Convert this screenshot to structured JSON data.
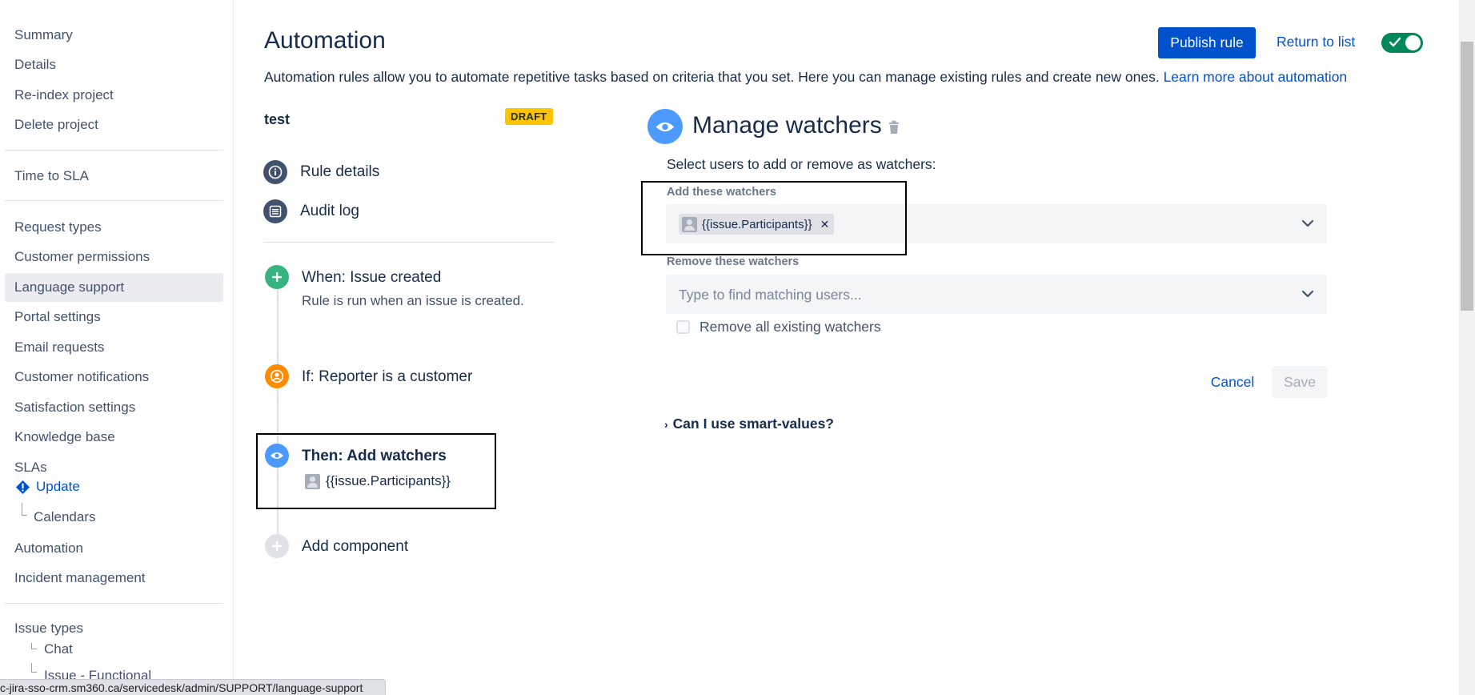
{
  "sidebar": {
    "items": [
      {
        "label": "Summary"
      },
      {
        "label": "Details"
      },
      {
        "label": "Re-index project"
      },
      {
        "label": "Delete project"
      },
      {
        "label": "Time to SLA"
      },
      {
        "label": "Request types"
      },
      {
        "label": "Customer permissions"
      },
      {
        "label": "Language support"
      },
      {
        "label": "Portal settings"
      },
      {
        "label": "Email requests"
      },
      {
        "label": "Customer notifications"
      },
      {
        "label": "Satisfaction settings"
      },
      {
        "label": "Knowledge base"
      },
      {
        "label": "SLAs"
      },
      {
        "label": "Automation"
      },
      {
        "label": "Incident management"
      },
      {
        "label": "Issue types"
      }
    ],
    "sla_update_label": "Update",
    "sla_calendars_label": "Calendars",
    "issue_types_children": [
      "Chat",
      "Issue - Functional"
    ]
  },
  "status_url": "c-jira-sso-crm.sm360.ca/servicedesk/admin/SUPPORT/language-support",
  "header": {
    "title": "Automation",
    "description": "Automation rules allow you to automate repetitive tasks based on criteria that you set. Here you can manage existing rules and create new ones.",
    "learn_more_label": "Learn more about automation",
    "publish_label": "Publish rule",
    "return_label": "Return to list",
    "rule_enabled": true
  },
  "rule": {
    "name": "test",
    "status_badge": "DRAFT",
    "links": [
      {
        "label": "Rule details",
        "icon": "info-icon"
      },
      {
        "label": "Audit log",
        "icon": "list-icon"
      }
    ],
    "steps": {
      "trigger_title": "When: Issue created",
      "trigger_desc": "Rule is run when an issue is created.",
      "condition_title": "If: Reporter is a customer",
      "action_title": "Then: Add watchers",
      "action_value": "{{issue.Participants}}",
      "add_component_label": "Add component"
    }
  },
  "panel": {
    "title": "Manage watchers",
    "instruction": "Select users to add or remove as watchers:",
    "add_label": "Add these watchers",
    "add_tag": "{{issue.Participants}}",
    "remove_label": "Remove these watchers",
    "remove_placeholder": "Type to find matching users...",
    "remove_all_label": "Remove all existing watchers",
    "remove_all_checked": false,
    "cancel_label": "Cancel",
    "save_label": "Save",
    "smart_values_label": "Can I use smart-values?"
  },
  "colors": {
    "primary": "#0052cc",
    "toggle_on": "#00875a",
    "draft": "#ffc400",
    "trigger_green": "#36b37e",
    "condition_orange": "#ff8b00",
    "action_blue": "#4c9aff"
  }
}
